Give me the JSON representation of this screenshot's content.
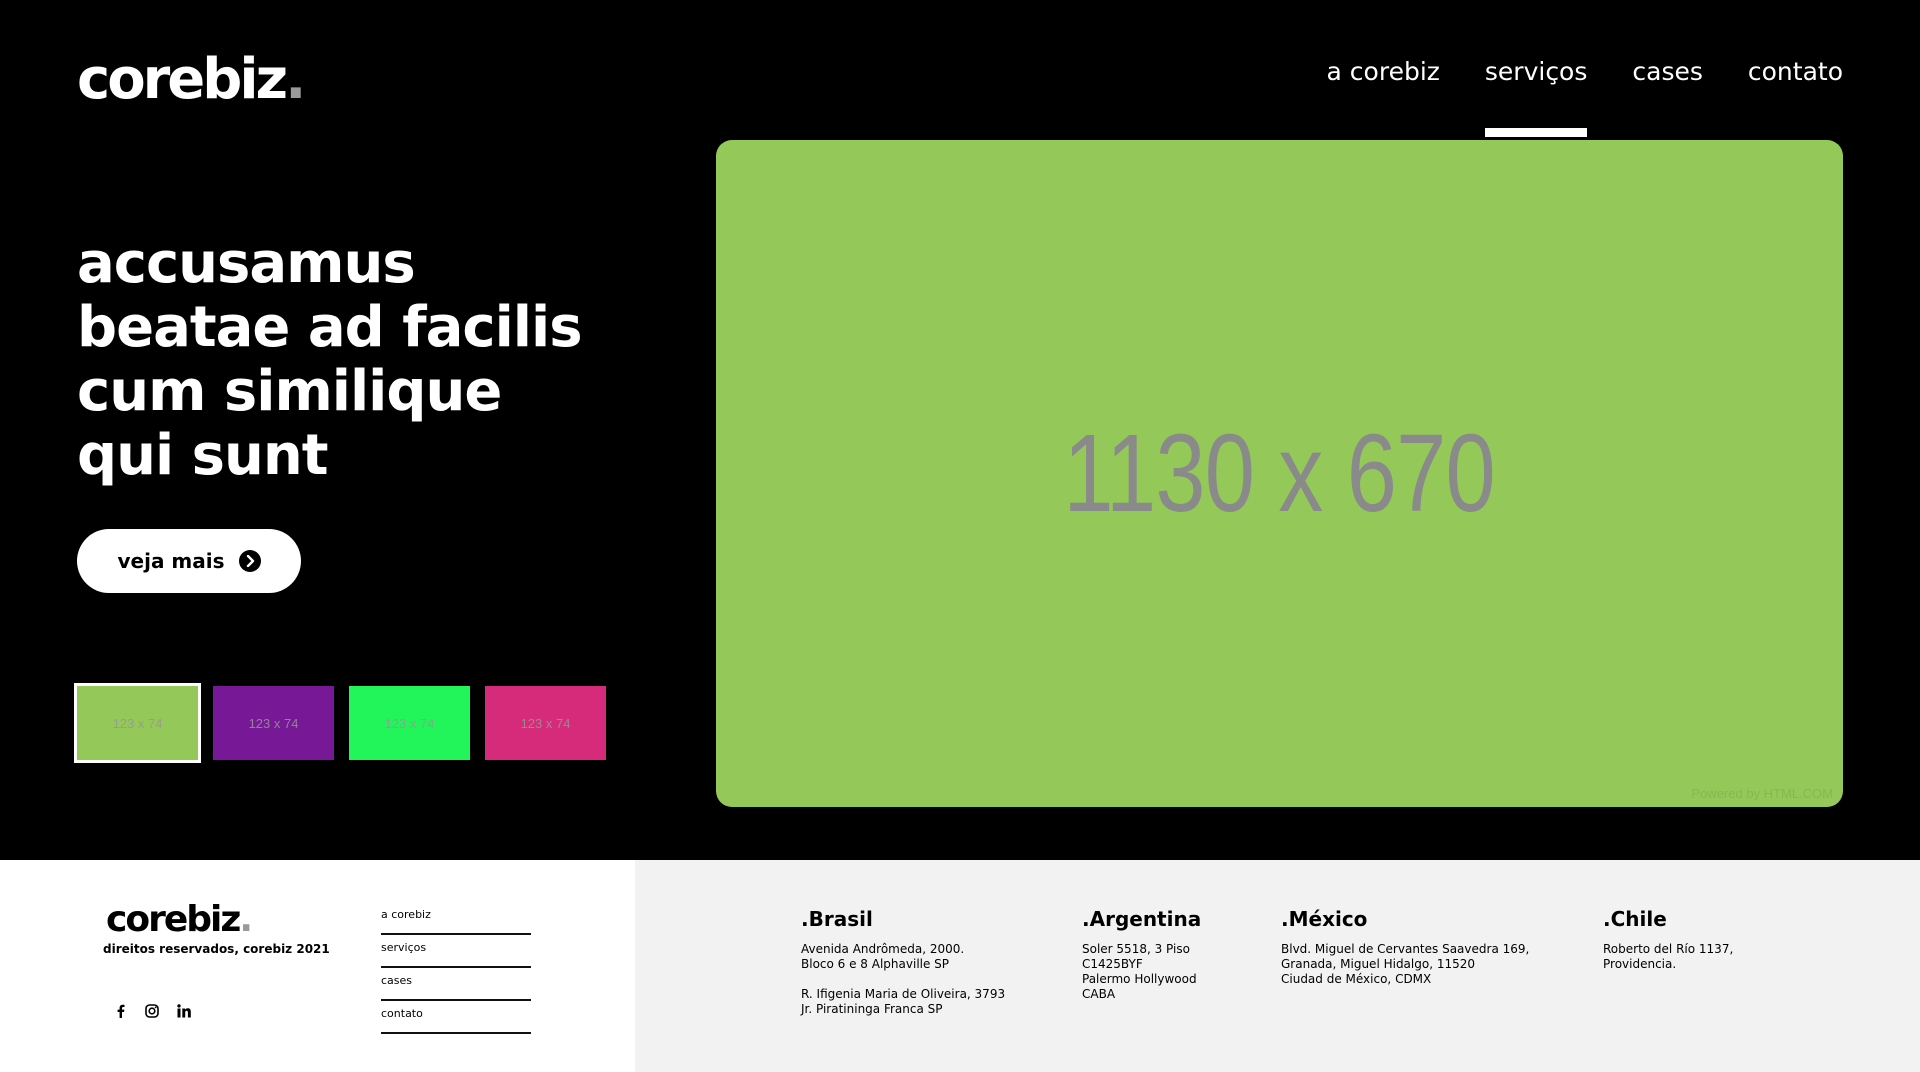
{
  "brand": {
    "name": "corebiz",
    "dot": ".",
    "dot_color": "#9a9a9a"
  },
  "nav": {
    "items": [
      {
        "label": "a corebiz",
        "active": false
      },
      {
        "label": "serviços",
        "active": true
      },
      {
        "label": "cases",
        "active": false
      },
      {
        "label": "contato",
        "active": false
      }
    ]
  },
  "hero": {
    "headline_lines": [
      "accusamus",
      "beatae ad facilis",
      "cum similique",
      "qui sunt"
    ],
    "cta_label": "veja mais",
    "cta_icon": "chevron-right-circle-icon",
    "main_image": {
      "label": "1130 x 670",
      "color": "#94c959",
      "powered_by": "Powered by HTML.COM"
    },
    "thumbnails": [
      {
        "label": "123 x 74",
        "color": "#94c959",
        "selected": true
      },
      {
        "label": "123 x 74",
        "color": "#771896",
        "selected": false
      },
      {
        "label": "123 x 74",
        "color": "#22f55a",
        "selected": false
      },
      {
        "label": "123 x 74",
        "color": "#d62a7b",
        "selected": false
      }
    ]
  },
  "footer": {
    "logo": "corebiz",
    "rights": "direitos reservados, corebiz 2021",
    "social": [
      "facebook-icon",
      "instagram-icon",
      "linkedin-icon"
    ],
    "links": [
      "a corebiz",
      "serviços",
      "cases",
      "contato"
    ],
    "offices": [
      {
        "country": ".Brasil",
        "address": "Avenida Andrômeda, 2000.\nBloco 6 e 8 Alphaville SP",
        "address2": "R. Ifigenia Maria de Oliveira, 3793\nJr. Piratininga Franca SP"
      },
      {
        "country": ".Argentina",
        "address": "Soler 5518, 3 Piso\nC1425BYF\nPalermo Hollywood\nCABA"
      },
      {
        "country": ".México",
        "address": "Blvd. Miguel de Cervantes Saavedra 169,\nGranada, Miguel Hidalgo, 11520\nCiudad de México, CDMX"
      },
      {
        "country": ".Chile",
        "address": "Roberto del Río 1137,\nProvidencia."
      }
    ]
  }
}
